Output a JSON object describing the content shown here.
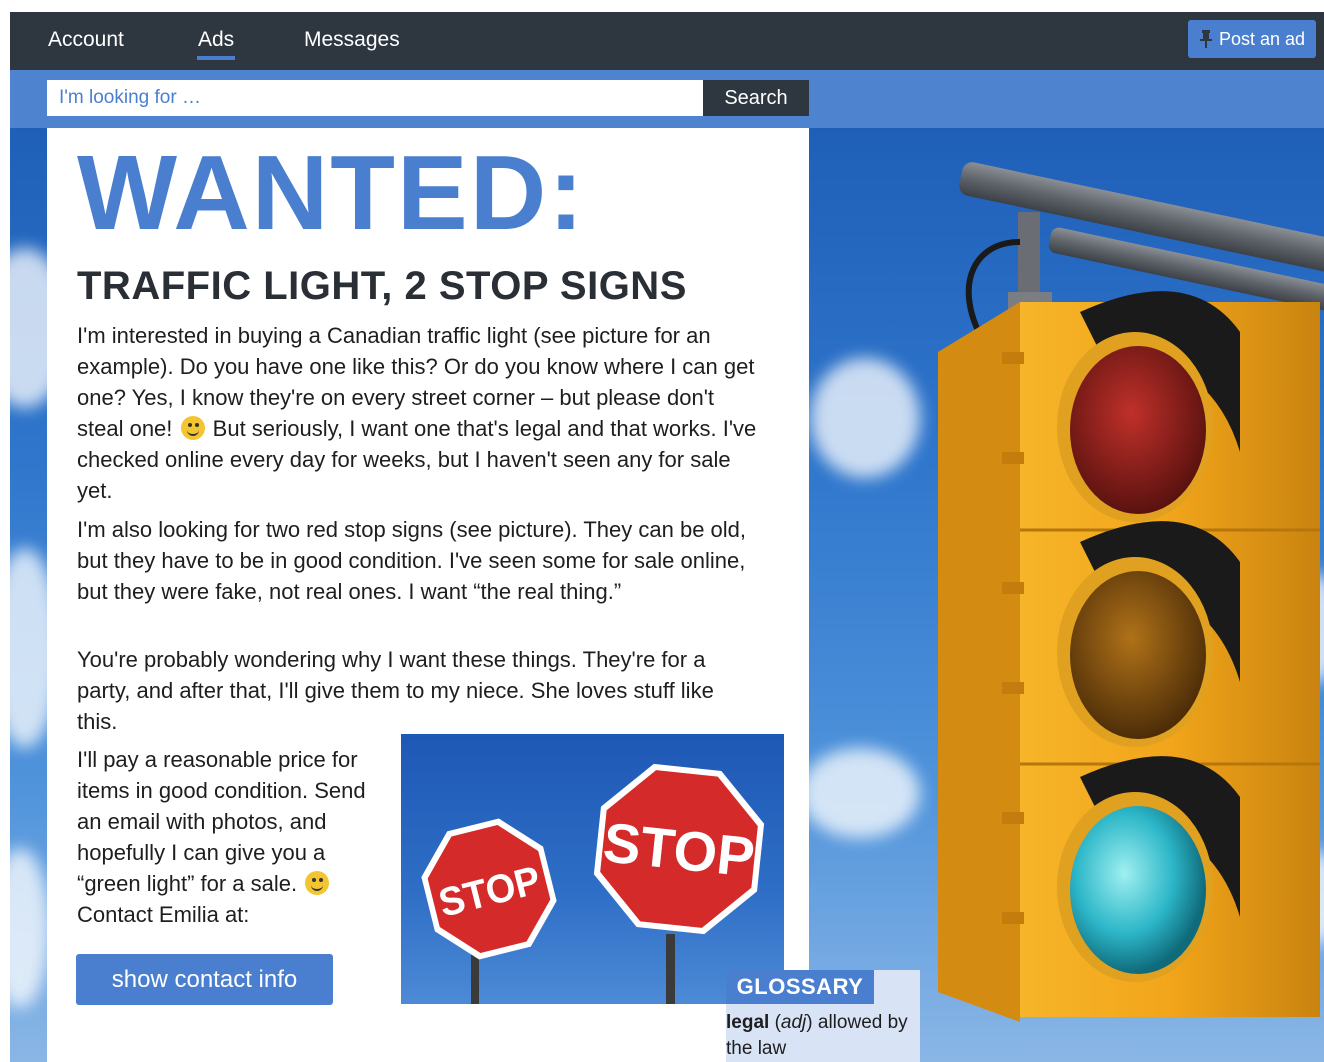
{
  "nav": {
    "items": [
      {
        "label": "Account"
      },
      {
        "label": "Ads"
      },
      {
        "label": "Messages"
      }
    ],
    "post_label": "Post an ad"
  },
  "search": {
    "placeholder": "I'm looking for …",
    "button_label": "Search"
  },
  "ad": {
    "headline": "WANTED:",
    "subhead": "TRAFFIC LIGHT, 2 STOP SIGNS",
    "p1_a": "I'm interested in buying a Canadian traffic light (see picture for an example). Do you have one like this? Or do you know where I can get one? Yes, I know they're on every street corner – but please don't steal one!",
    "p1_b": "But seriously, I want one that's legal and that works. I've checked online every day for weeks, but I haven't seen any for sale yet.",
    "p2": "I'm also looking for two red stop signs (see picture). They can be old, but they have to be in good condition. I've seen some for sale online, but they were fake, not real ones. I want “the real thing.”",
    "p3": "You're probably wondering why I want these things. They're for a party, and after that, I'll give them to my niece. She loves stuff like this.",
    "p4_a": "I'll pay a reasonable price for items in good condition. Send an email with photos, and hopefully I can give you a “green light” for a sale.",
    "p4_b": "Contact Emilia at:",
    "contact_button": "show contact info"
  },
  "stop_signs": {
    "left_text": "STOP",
    "right_text": "STOP"
  },
  "glossary": {
    "title": "GLOSSARY",
    "term": "legal",
    "pos": "adj",
    "definition": "allowed by the law"
  },
  "colors": {
    "accent": "#4a7fd0",
    "nav_bg": "#2e3640",
    "stop_red": "#d42a2a",
    "light_body": "#f2a81d"
  }
}
